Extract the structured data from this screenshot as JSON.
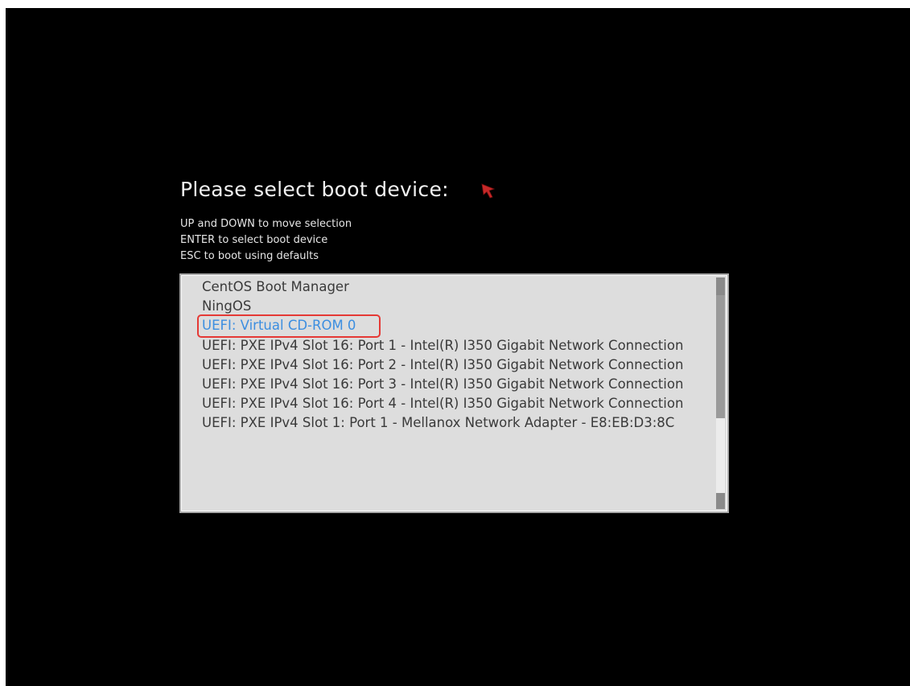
{
  "title": "Please select boot device:",
  "instructions": [
    "UP and DOWN to move selection",
    "ENTER to select boot device",
    "ESC to boot using defaults"
  ],
  "boot_devices": [
    {
      "label": "CentOS Boot Manager",
      "selected": false
    },
    {
      "label": "NingOS",
      "selected": false
    },
    {
      "label": "UEFI: Virtual CD-ROM 0",
      "selected": true
    },
    {
      "label": "UEFI: PXE IPv4 Slot 16: Port 1 - Intel(R) I350 Gigabit Network Connection",
      "selected": false
    },
    {
      "label": "UEFI: PXE IPv4 Slot 16: Port 2 - Intel(R) I350 Gigabit Network Connection",
      "selected": false
    },
    {
      "label": "UEFI: PXE IPv4 Slot 16: Port 3 - Intel(R) I350 Gigabit Network Connection",
      "selected": false
    },
    {
      "label": "UEFI: PXE IPv4 Slot 16: Port 4 - Intel(R) I350 Gigabit Network Connection",
      "selected": false
    },
    {
      "label": "UEFI: PXE IPv4 Slot 1: Port 1 - Mellanox Network Adapter - E8:EB:D3:8C",
      "selected": false
    }
  ],
  "colors": {
    "background": "#000000",
    "list_background": "#dddddd",
    "item_text": "#3a3a3a",
    "selected_text": "#3c8ee0",
    "annotation_box": "#e53935",
    "cursor": "#c62828"
  },
  "icons": {
    "cursor": "mouse-pointer-icon"
  }
}
